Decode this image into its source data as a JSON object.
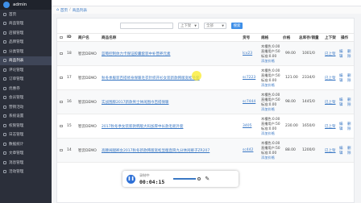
{
  "sidebar": {
    "admin_label": "admin",
    "items": [
      {
        "label": "首页",
        "active": false
      },
      {
        "label": "商品管理",
        "active": false
      },
      {
        "label": "店铺管理",
        "active": false
      },
      {
        "label": "品牌管理",
        "active": false
      },
      {
        "label": "分类管理",
        "active": false
      },
      {
        "label": "商品列表",
        "active": true
      },
      {
        "label": "评论管理",
        "active": false
      },
      {
        "label": "订单管理",
        "active": false
      },
      {
        "label": "优惠券",
        "active": false
      },
      {
        "label": "会员管理",
        "active": false
      },
      {
        "label": "营销活动",
        "active": false
      },
      {
        "label": "系统设置",
        "active": false
      },
      {
        "label": "权限管理",
        "active": false
      },
      {
        "label": "日志管理",
        "active": false
      },
      {
        "label": "数据统计",
        "active": false
      },
      {
        "label": "文章管理",
        "active": false
      },
      {
        "label": "消息管理",
        "active": false
      },
      {
        "label": "活动管理",
        "active": false
      }
    ]
  },
  "breadcrumb": {
    "home": "首页",
    "sep": "/",
    "current": "商品列表"
  },
  "filters": {
    "search_placeholder": "",
    "status_select": "上下架",
    "category_select": "全部",
    "search_button": "搜索"
  },
  "table": {
    "headers": {
      "id": "ID",
      "shop": "商户名",
      "name": "商品名称",
      "sku": "货号",
      "spec": "规格",
      "price": "价格",
      "stock": "总库存/销量",
      "status": "上下架",
      "ops": "操作"
    },
    "rows": [
      {
        "id": "18",
        "shop": "智云DEMO",
        "name": "蓝莓控制体力卡保证胶囊套装中补营养元素",
        "sku": "lcv23",
        "specs": [
          "木槿色:0.00",
          "直播用户:50",
          "标准:0.00",
          "添加价格"
        ],
        "price": "99.00",
        "stock": "1001/0",
        "status": "已上架",
        "ops": [
          "编辑",
          "删除"
        ]
      },
      {
        "id": "17",
        "shop": "智云DEMO",
        "name": "秋冬季服装百搭修身保暖毛衣针织开衫女装新款韩版宽松外套",
        "sku": "sc7223",
        "specs": [
          "木槿色:0.00",
          "直播用户:50",
          "标准:0.00",
          "添加价格"
        ],
        "price": "121.00",
        "stock": "2334/0",
        "status": "已上架",
        "ops": [
          "编辑",
          "删除"
        ]
      },
      {
        "id": "16",
        "shop": "智云DEMO",
        "name": "实战围脖2017新款男士休闲围巾百搭保暖",
        "sku": "sc7444",
        "specs": [
          "木槿色:0.00",
          "直播用户:50",
          "标准:0.00",
          "添加价格"
        ],
        "price": "98.00",
        "stock": "1445/0",
        "status": "已上架",
        "ops": [
          "编辑",
          "删除"
        ]
      },
      {
        "id": "15",
        "shop": "智云DEMO",
        "name": "2017秋冬季女装新款韩版大码加厚中长款毛呢外套",
        "sku": "3405",
        "specs": [
          "木槿色:0.00",
          "直播用户:50",
          "标准:0.00",
          "添加价格"
        ],
        "price": "230.00",
        "stock": "1650/0",
        "status": "已上架",
        "ops": [
          "编辑",
          "删除"
        ]
      },
      {
        "id": "14",
        "shop": "智云DEMO",
        "name": "高腰阔腿裤女2017秋冬新款韩版宽松显瘦直筒九分休闲裤子ZR207",
        "sku": "sc442",
        "specs": [
          "木槿色:0.00",
          "直播用户:50",
          "标准:0.00",
          "添加价格"
        ],
        "price": "88.00",
        "stock": "1200/0",
        "status": "已上架",
        "ops": [
          "编辑",
          "删除"
        ]
      }
    ]
  },
  "player": {
    "label": "录制中",
    "time": "00:04:15"
  },
  "colors": {
    "accent": "#3e8fe8",
    "sidebar_bg": "#2b2f3a",
    "link": "#3a78c4"
  }
}
